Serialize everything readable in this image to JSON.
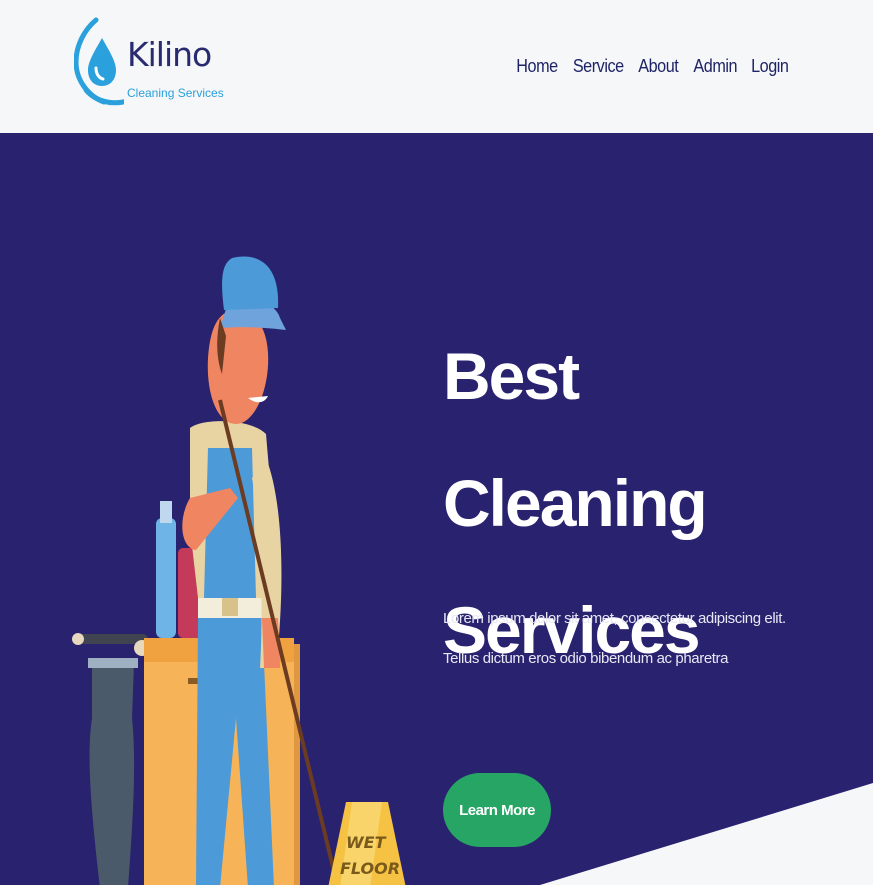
{
  "brand": {
    "name": "Kilino",
    "tagline": "Cleaning Services",
    "logo_icon": "water-drop-icon",
    "colors": {
      "primary": "#29226f",
      "accent": "#2aa0dc",
      "navy_text": "#1f2466"
    }
  },
  "nav": {
    "items": [
      {
        "label": "Home"
      },
      {
        "label": "Service"
      },
      {
        "label": "About"
      },
      {
        "label": "Admin"
      },
      {
        "label": "Login"
      }
    ]
  },
  "hero": {
    "title_line1": "Best Cleaning",
    "title_line2": "Services",
    "description": "Lorem ipsum dolor sit amet, consectetur adipiscing elit. Tellus dictum eros odio bibendum ac pharetra",
    "cta_label": "Learn More",
    "cta_color": "#27a565",
    "illustration": {
      "subject": "janitor-with-mop-and-cleaning-cart",
      "sign_text_line1": "WET",
      "sign_text_line2": "FLOOR"
    }
  }
}
